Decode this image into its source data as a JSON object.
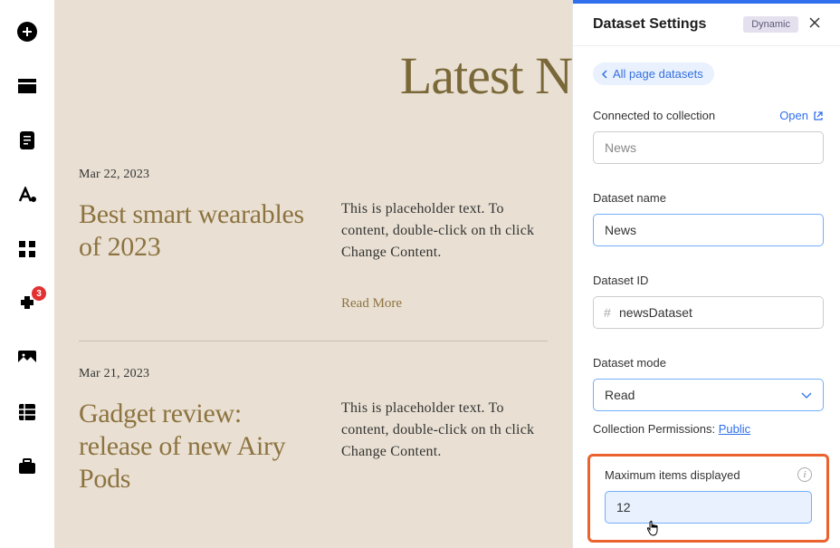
{
  "sidebar": {
    "badge_count": "3"
  },
  "canvas": {
    "page_title": "Latest N",
    "articles": [
      {
        "date": "Mar 22, 2023",
        "title": "Best smart wearables of 2023",
        "body": "This is placeholder text. To content, double-click on th click Change Content.",
        "read_more": "Read More"
      },
      {
        "date": "Mar 21, 2023",
        "title": "Gadget review: release of new Airy Pods",
        "body": "This is placeholder text. To content, double-click on th click Change Content."
      }
    ]
  },
  "panel": {
    "title": "Dataset Settings",
    "badge": "Dynamic",
    "back_link": "All page datasets",
    "connected_label": "Connected to collection",
    "open_label": "Open",
    "collection_value": "News",
    "name_label": "Dataset name",
    "name_value": "News",
    "id_label": "Dataset ID",
    "id_value": "newsDataset",
    "mode_label": "Dataset mode",
    "mode_value": "Read",
    "perm_prefix": "Collection Permissions: ",
    "perm_value": "Public",
    "max_label": "Maximum items displayed",
    "max_value": "12"
  }
}
